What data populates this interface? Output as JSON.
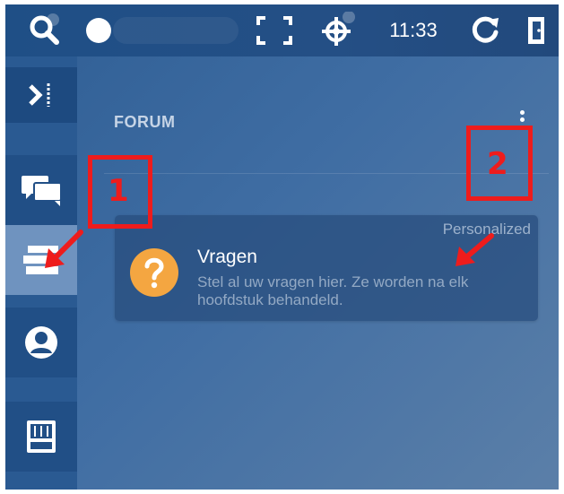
{
  "topbar": {
    "time": "11:33",
    "icons": [
      "search-icon",
      "status-dot-icon",
      "fullscreen-icon",
      "crosshair-icon",
      "refresh-icon",
      "exit-door-icon"
    ]
  },
  "sidebar": {
    "items": [
      {
        "name": "collapse",
        "icon": "collapse-sidebar-icon"
      },
      {
        "name": "chat",
        "icon": "chat-bubbles-icon"
      },
      {
        "name": "forum",
        "icon": "forum-stack-icon",
        "active": true
      },
      {
        "name": "profile",
        "icon": "user-icon"
      },
      {
        "name": "tools",
        "icon": "toolbox-icon"
      }
    ]
  },
  "main": {
    "title": "FORUM",
    "card": {
      "badge": "Personalized",
      "title": "Vragen",
      "description": "Stel al uw vragen hier. Ze worden na elk hoofdstuk behandeld."
    }
  },
  "annotations": {
    "label1": "1",
    "label2": "2",
    "color": "#ee1c1c"
  },
  "colors": {
    "topbar": "#244f85",
    "sidebar": "#2a5a92",
    "active": "#6f93bf",
    "question": "#f4a641"
  }
}
